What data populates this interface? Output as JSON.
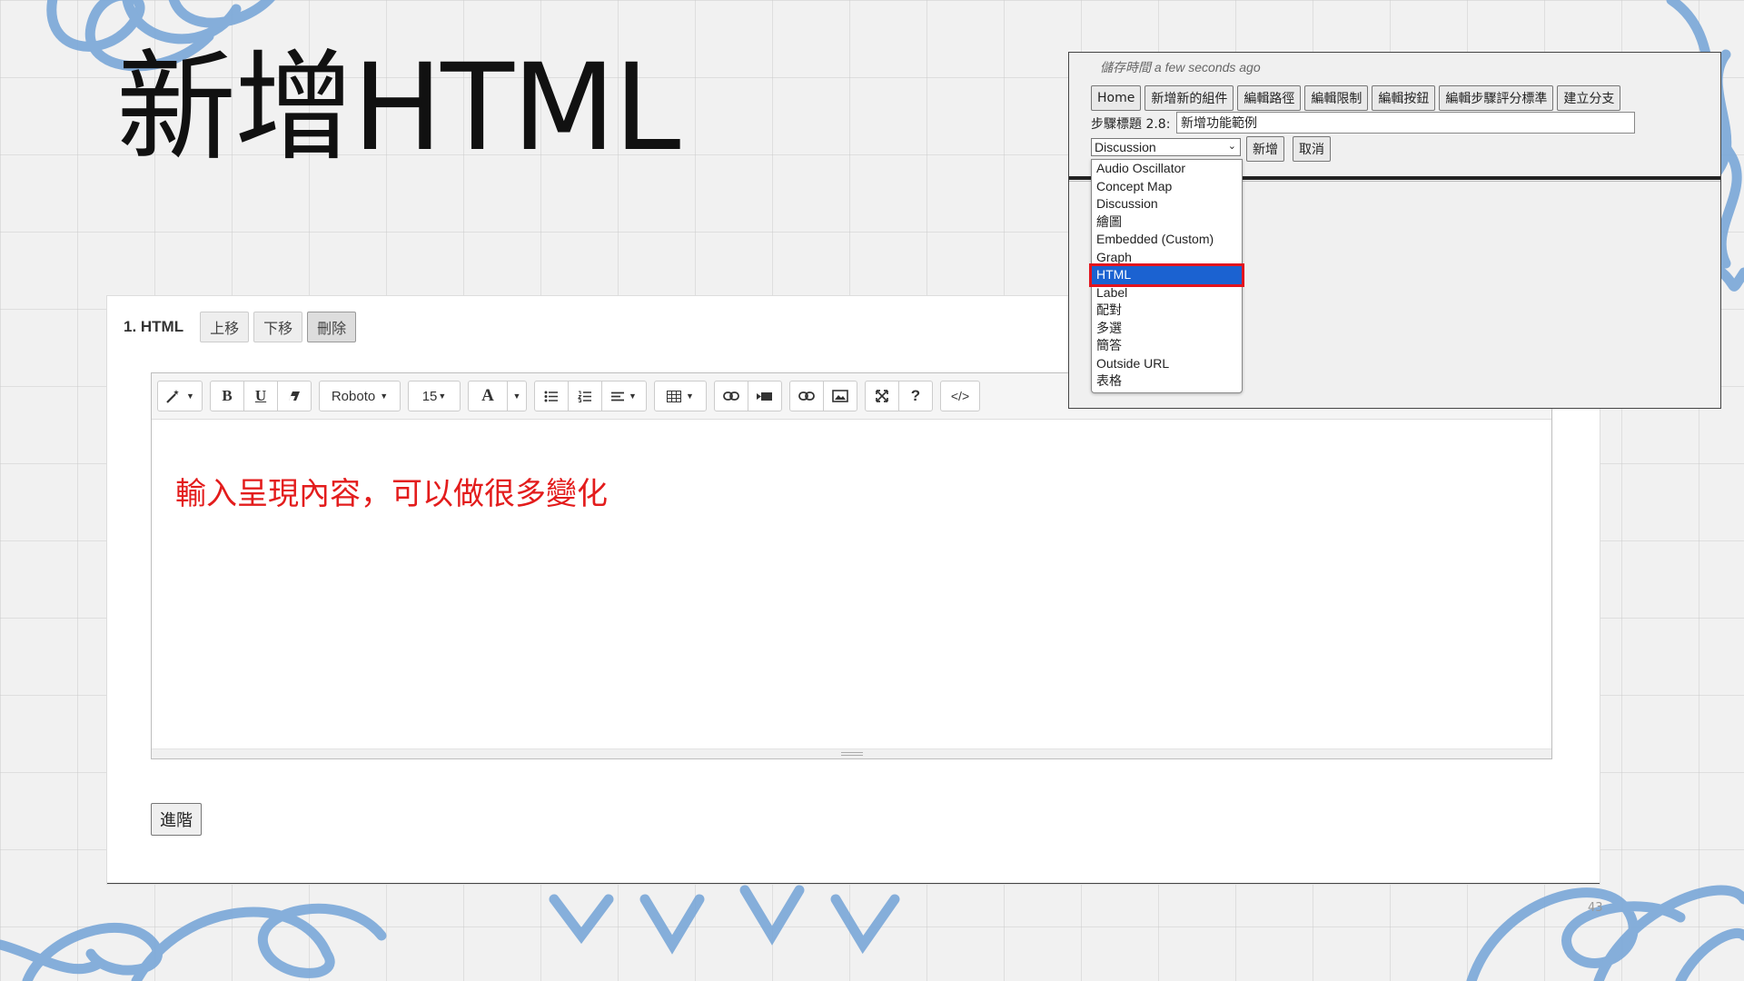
{
  "slide": {
    "title": "新增HTML",
    "page_number": "43"
  },
  "component": {
    "title": "1. HTML",
    "move_up": "上移",
    "move_down": "下移",
    "delete": "刪除",
    "advanced": "進階"
  },
  "editor": {
    "toolbar": {
      "magic": "magic-icon",
      "bold": "B",
      "underline": "U",
      "eraser": "eraser-icon",
      "font": "Roboto",
      "size": "15",
      "color": "A",
      "help": "?",
      "code": "</>"
    },
    "content": "輸入呈現內容，可以做很多變化",
    "text_color": "#e31c1c"
  },
  "inset": {
    "save_time": "儲存時間 a few seconds ago",
    "buttons": [
      "Home",
      "新增新的組件",
      "編輯路徑",
      "編輯限制",
      "編輯按鈕",
      "編輯步驟評分標準",
      "建立分支"
    ],
    "step_label": "步驟標題 2.8:",
    "step_value": "新增功能範例",
    "select_value": "Discussion",
    "add": "新增",
    "cancel": "取消",
    "options": [
      "Audio Oscillator",
      "Concept Map",
      "Discussion",
      "繪圖",
      "Embedded (Custom)",
      "Graph",
      "HTML",
      "Label",
      "配對",
      "多選",
      "簡答",
      "Outside URL",
      "表格"
    ],
    "highlighted_option": "HTML",
    "highlight_color": "#1b62d1",
    "callout_color": "#e3141e"
  }
}
